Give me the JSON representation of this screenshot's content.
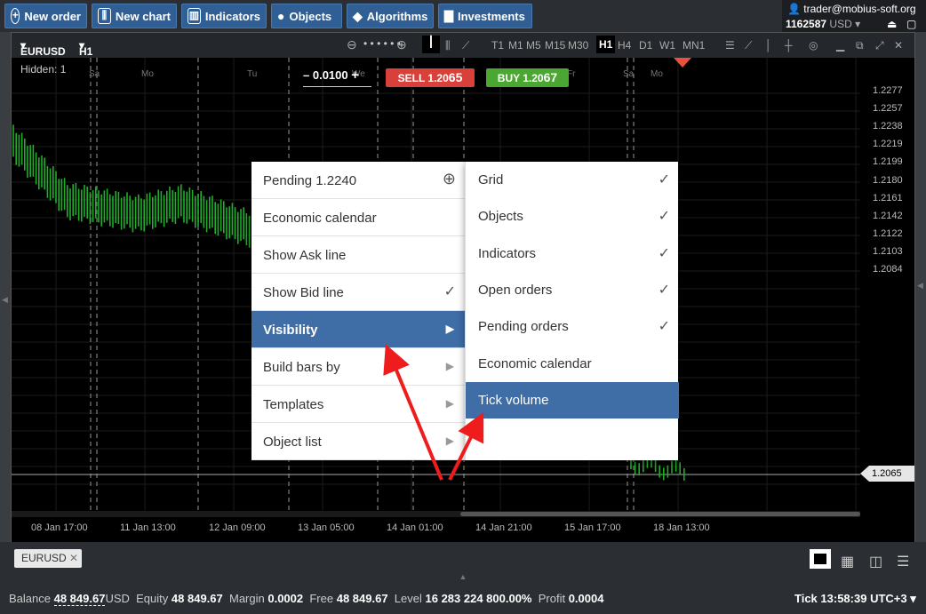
{
  "toolbar": {
    "new_order": "New order",
    "new_chart": "New chart",
    "indicators": "Indicators",
    "objects": "Objects",
    "algorithms": "Algorithms",
    "investments": "Investments"
  },
  "account": {
    "email": "trader@mobius-soft.org",
    "number": "1162587",
    "currency": "USD"
  },
  "chart": {
    "symbol": "EURUSD",
    "timeframe": "H1",
    "hidden": "Hidden: 1",
    "lot": "0.0100",
    "sell_label": "SELL 1.20",
    "sell_big": "65",
    "buy_label": "BUY 1.20",
    "buy_big": "67",
    "timeframes": [
      "T1",
      "M1",
      "M5",
      "M15",
      "M30",
      "H1",
      "H4",
      "D1",
      "W1",
      "MN1"
    ],
    "active_timeframe": "H1",
    "price_ticks": [
      "1.2277",
      "1.2257",
      "1.2238",
      "1.2219",
      "1.2199",
      "1.2180",
      "1.2161",
      "1.2142",
      "1.2122",
      "1.2103",
      "1.2084",
      "1.2065"
    ],
    "current_price": "1.2065",
    "time_ticks": [
      "08 Jan 17:00",
      "11 Jan 13:00",
      "12 Jan 09:00",
      "13 Jan 05:00",
      "14 Jan 01:00",
      "14 Jan 21:00",
      "15 Jan 17:00",
      "18 Jan 13:00"
    ],
    "day_labels": [
      "Sa",
      "Mo",
      "Tu",
      "We",
      "Fr",
      "Sa",
      "Mo"
    ]
  },
  "context_menu": {
    "items": [
      "Pending 1.2240",
      "Economic calendar",
      "Show Ask line",
      "Show Bid line",
      "Visibility",
      "Build bars by",
      "Templates",
      "Object list"
    ],
    "selected": "Visibility"
  },
  "submenu": {
    "items": [
      "Grid",
      "Objects",
      "Indicators",
      "Open orders",
      "Pending orders",
      "Economic calendar",
      "Tick volume"
    ],
    "checked": [
      true,
      true,
      true,
      true,
      true,
      false,
      false
    ],
    "selected": "Tick volume"
  },
  "tabs": {
    "active": "EURUSD"
  },
  "status": {
    "balance_label": "Balance",
    "balance": "48 849.67",
    "balance_cur": "USD",
    "equity_label": "Equity",
    "equity": "48 849.67",
    "margin_label": "Margin",
    "margin": "0.0002",
    "free_label": "Free",
    "free": "48 849.67",
    "level_label": "Level",
    "level": "16 283 224 800.00%",
    "profit_label": "Profit",
    "profit": "0.0004",
    "tick_label": "Tick",
    "tick": "13:58:39",
    "tz": "UTC+3"
  },
  "colors": {
    "accent": "#3f6da6",
    "sell": "#d9403a",
    "buy": "#4aa832",
    "candle": "#1fae2a"
  }
}
